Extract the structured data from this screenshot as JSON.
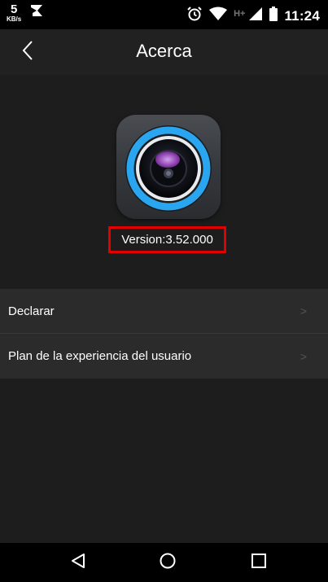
{
  "status_bar": {
    "net_speed_value": "5",
    "net_speed_unit": "KB/s",
    "network_type": "H+",
    "time": "11:24",
    "icons": [
      "notification-flag-icon",
      "alarm-icon",
      "wifi-icon",
      "signal-icon",
      "battery-icon"
    ]
  },
  "header": {
    "title": "Acerca",
    "back_icon": "back-chevron-icon"
  },
  "about": {
    "app_icon": "camera-lens-icon",
    "version": "Version:3.52.000",
    "highlight_color": "#e30000"
  },
  "menu": {
    "items": [
      {
        "label": "Declarar"
      },
      {
        "label": "Plan de la experiencia del usuario"
      }
    ],
    "chevron": ">"
  },
  "nav_bar": {
    "icons": [
      "back-triangle-icon",
      "home-circle-icon",
      "recents-square-icon"
    ]
  },
  "colors": {
    "background": "#1d1d1d",
    "header": "#212121",
    "menu": "#2b2b2b",
    "accent_ring": "#2aa6f0"
  }
}
